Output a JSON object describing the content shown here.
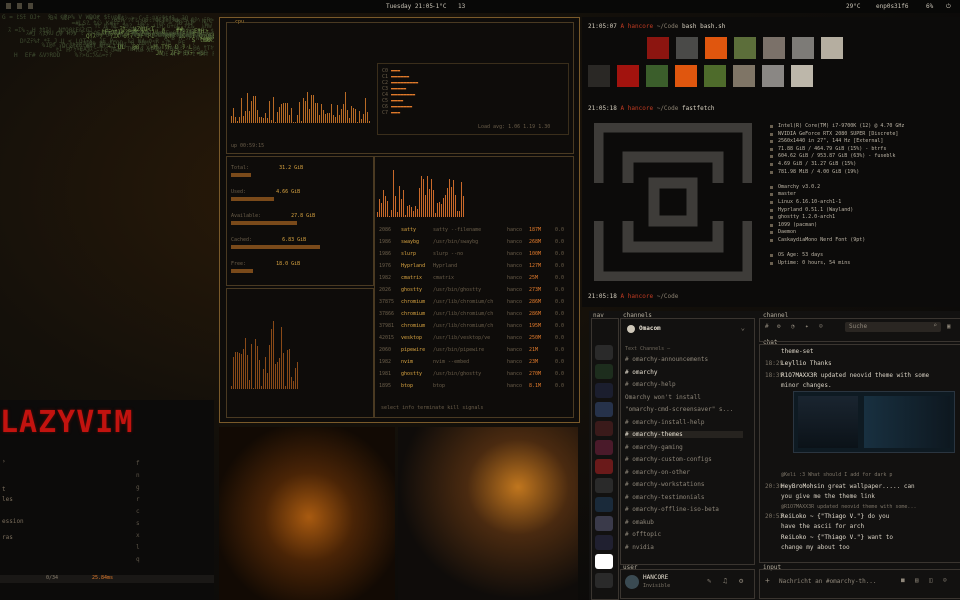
{
  "topbar": {
    "clock": "Tuesday 21:05",
    "weather": "-1°C",
    "cpu_temp": "29°C",
    "network": "enp0s31f6",
    "volume": "6%",
    "workspace": "13"
  },
  "colors": {
    "accent": "#e07a2b",
    "red": "#c23b22",
    "green": "#8dc63f",
    "bg": "#0b0a09"
  },
  "btop": {
    "title": "cpu",
    "uptime": "up 00:59:15",
    "load": "Load avg: 1.06 1.19 1.30",
    "mem_labels": [
      "Total:",
      "Used:",
      "Available:",
      "Cached:",
      "Free:"
    ],
    "mem_values": [
      "31.2 GiB",
      "4.66 GiB",
      "27.8 GiB",
      "6.83 GiB",
      "18.0 GiB"
    ],
    "procs": [
      {
        "pid": "2086",
        "name": "satty",
        "cmd": "satty --filename",
        "user": "hanco",
        "mem": "187M",
        "cpu": "0.0"
      },
      {
        "pid": "1986",
        "name": "swaybg",
        "cmd": "/usr/bin/swaybg",
        "user": "hanco",
        "mem": "268M",
        "cpu": "0.0"
      },
      {
        "pid": "1986",
        "name": "slurp",
        "cmd": "slurp --no",
        "user": "hanco",
        "mem": "100M",
        "cpu": "0.0"
      },
      {
        "pid": "1976",
        "name": "Hyprland",
        "cmd": "Hyprland",
        "user": "hanco",
        "mem": "127M",
        "cpu": "0.0"
      },
      {
        "pid": "1982",
        "name": "cmatrix",
        "cmd": "cmatrix",
        "user": "hanco",
        "mem": "25M",
        "cpu": "0.0"
      },
      {
        "pid": "2026",
        "name": "ghostty",
        "cmd": "/usr/bin/ghostty",
        "user": "hanco",
        "mem": "273M",
        "cpu": "0.0"
      },
      {
        "pid": "37875",
        "name": "chromium",
        "cmd": "/usr/lib/chromium/ch",
        "user": "hanco",
        "mem": "286M",
        "cpu": "0.0"
      },
      {
        "pid": "37866",
        "name": "chromium",
        "cmd": "/usr/lib/chromium/ch",
        "user": "hanco",
        "mem": "286M",
        "cpu": "0.0"
      },
      {
        "pid": "37981",
        "name": "chromium",
        "cmd": "/usr/lib/chromium/ch",
        "user": "hanco",
        "mem": "195M",
        "cpu": "0.0"
      },
      {
        "pid": "42015",
        "name": "vesktop",
        "cmd": "/usr/lib/vesktop/ve",
        "user": "hanco",
        "mem": "250M",
        "cpu": "0.0"
      },
      {
        "pid": "2060",
        "name": "pipewire",
        "cmd": "/usr/bin/pipewire",
        "user": "hanco",
        "mem": "21M",
        "cpu": "0.0"
      },
      {
        "pid": "1982",
        "name": "nvim",
        "cmd": "nvim --embed",
        "user": "hanco",
        "mem": "23M",
        "cpu": "0.0"
      },
      {
        "pid": "1981",
        "name": "ghostty",
        "cmd": "/usr/bin/ghostty",
        "user": "hanco",
        "mem": "270M",
        "cpu": "0.0"
      },
      {
        "pid": "1895",
        "name": "btop",
        "cmd": "btop",
        "user": "hanco",
        "mem": "8.1M",
        "cpu": "0.0"
      }
    ],
    "footer": "select  info  terminate  kill  signals"
  },
  "term1": {
    "prompt1_time": "21:05:07",
    "prompt1_user": "hancore",
    "prompt1_path": "~/Code",
    "prompt1_cmd": "bash bash.sh",
    "prompt2_time": "21:05:18",
    "prompt2_cmd": "fastfetch",
    "prompt3_time": "21:05:18",
    "swatches_top": [
      "#0b0a09",
      "#8c1510",
      "#4a4a48",
      "#e0560e",
      "#5c6e3a",
      "#7b7169",
      "#7d7b77",
      "#b5aea0"
    ],
    "swatches_bottom": [
      "#2a2825",
      "#a2130e",
      "#3b5e2b",
      "#e0560e",
      "#4e6b2b",
      "#7f7566",
      "#8a8784",
      "#bdb7aa"
    ],
    "fetch_lines": [
      "Intel(R) Core(TM) i7-9700K (12) @ 4.70 GHz",
      "NVIDIA GeForce RTX 2080 SUPER [Discrete]",
      "2560x1440 in 27\", 144 Hz [External]",
      "71.88 GiB / 464.79 GiB (15%) - btrfs",
      "604.62 GiB / 953.87 GiB (63%) - fuseblk",
      "4.69 GiB / 31.27 GiB (15%)",
      "781.98 MiB / 4.00 GiB (19%)",
      "",
      "Omarchy v3.0.2",
      "master",
      "Linux 6.16.10-arch1-1",
      "Hyprland 0.51.1 (Wayland)",
      "ghostty 1.2.0-arch1",
      "1099 (pacman)",
      "Daemon",
      "CaskaydiaMono Nerd Font (9pt)",
      "",
      "OS Age: 53 days",
      "Uptime: 0 hours, 54 mins"
    ]
  },
  "discord": {
    "nav": "nav",
    "channels_label": "channels",
    "channel_label": "channel",
    "chat_label": "chat",
    "input_label": "input",
    "user_label": "user",
    "server_name": "Omacom",
    "search_placeholder": "Suche",
    "text_channels_header": "Text Channels —",
    "channels": [
      "omarchy-announcements",
      "omarchy",
      "omarchy-help",
      "Omarchy won't install",
      "\"omarchy-cmd-screensaver\" s...",
      "omarchy-install-help",
      "omarchy-themes",
      "omarchy-gaming",
      "omarchy-custom-configs",
      "omarchy-on-other",
      "omarchy-workstations",
      "omarchy-testimonials",
      "omarchy-offline-iso-beta",
      "omakub",
      "offtopic",
      "nvidia"
    ],
    "messages": [
      {
        "time": "",
        "nick": "",
        "text": "theme-set"
      },
      {
        "time": "18:29",
        "nick": "Leyllio",
        "text": "Thanks"
      },
      {
        "time": "18:39",
        "nick": "R1O7MAXX3R",
        "text": "updated neovid theme with some"
      },
      {
        "time": "",
        "nick": "",
        "text": "minor changes."
      },
      {
        "time": "",
        "nick": "",
        "text": "@Keli :3 What should I add for dark p"
      },
      {
        "time": "20:30",
        "nick": "HeyBroMohsin",
        "text": "great wallpaper..... can"
      },
      {
        "time": "",
        "nick": "",
        "text": "you give me the theme link"
      },
      {
        "time": "",
        "nick": "",
        "text": "@R1O7MAXX3R updated neovid theme with some..."
      },
      {
        "time": "20:53",
        "nick": "ReiLoko ~ {\"Thiago V.\"}",
        "text": "do you"
      },
      {
        "time": "",
        "nick": "",
        "text": "have the ascii for arch"
      },
      {
        "time": "",
        "nick": "ReiLoko ~ {\"Thiago V.\"}",
        "text": "want to"
      },
      {
        "time": "",
        "nick": "",
        "text": "change my about too"
      }
    ],
    "input_placeholder": "Nachricht an #omarchy-th...",
    "username": "HANCORE",
    "status": "Invisible"
  },
  "lazyvim": {
    "logo": "LAZYVIM",
    "status_left": "0/34",
    "status_right": "25.84ms"
  }
}
